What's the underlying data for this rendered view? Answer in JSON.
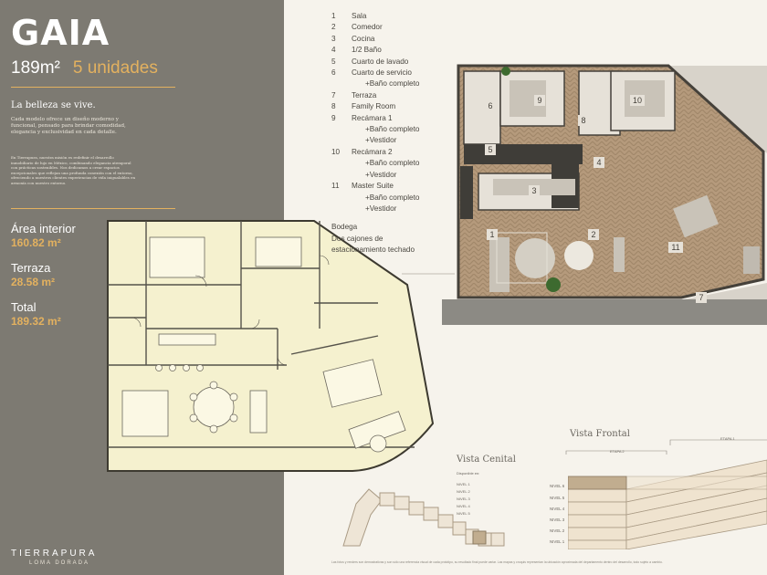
{
  "header": {
    "model_name": "GAIA",
    "size": "189m²",
    "units": "5 unidades"
  },
  "intro": {
    "tagline": "La belleza se vive.",
    "paragraph1": "Cada modelo ofrece un diseño moderno y funcional, pensado para brindar comodidad, elegancia y exclusividad en cada detalle.",
    "paragraph2": "En Tierrapura, nuestra misión es redefinir el desarrollo inmobiliario de lujo en México, combinando elegancia atemporal con prácticas sostenibles. Nos dedicamos a crear espacios excepcionales que reflejan una profunda conexión con el entorno, ofreciendo a nuestros clientes experiencias de vida inigualables en armonía con nuestro entorno."
  },
  "areas": [
    {
      "label": "Área interior",
      "value": "160.82 m²"
    },
    {
      "label": "Terraza",
      "value": "28.58 m²"
    },
    {
      "label": "Total",
      "value": "189.32 m²"
    }
  ],
  "brand": {
    "name": "TIERRAPURA",
    "location": "LOMA DORADA"
  },
  "room_legend": [
    {
      "num": "1",
      "name": "Sala",
      "extras": []
    },
    {
      "num": "2",
      "name": "Comedor",
      "extras": []
    },
    {
      "num": "3",
      "name": "Cocina",
      "extras": []
    },
    {
      "num": "4",
      "name": "1/2 Baño",
      "extras": []
    },
    {
      "num": "5",
      "name": "Cuarto de lavado",
      "extras": []
    },
    {
      "num": "6",
      "name": "Cuarto de servicio",
      "extras": [
        "+Baño completo"
      ]
    },
    {
      "num": "7",
      "name": "Terraza",
      "extras": []
    },
    {
      "num": "8",
      "name": "Family Room",
      "extras": []
    },
    {
      "num": "9",
      "name": "Recámara 1",
      "extras": [
        "+Baño completo",
        "+Vestidor"
      ]
    },
    {
      "num": "10",
      "name": "Recámara 2",
      "extras": [
        "+Baño completo",
        "+Vestidor"
      ]
    },
    {
      "num": "11",
      "name": "Master Suite",
      "extras": [
        "+Baño completo",
        "+Vestidor"
      ]
    }
  ],
  "extras": [
    "Bodega",
    "Dos cajones de",
    "estacionamiento techado"
  ],
  "plan_numbers": [
    "1",
    "2",
    "3",
    "4",
    "5",
    "6",
    "7",
    "8",
    "9",
    "10",
    "11"
  ],
  "vista_cenital": {
    "title": "Vista Cenital",
    "subtitle": "Disponible en:",
    "levels": [
      "NIVEL 1",
      "NIVEL 2",
      "NIVEL 3",
      "NIVEL 4",
      "NIVEL 5"
    ]
  },
  "vista_frontal": {
    "title": "Vista Frontal",
    "etapa1": "ETAPA 1",
    "etapa2": "ETAPA 2",
    "levels": [
      "NIVEL 6",
      "NIVEL 5",
      "NIVEL 4",
      "NIVEL 3",
      "NIVEL 2",
      "NIVEL 1"
    ]
  },
  "footnote": "Las fotos y renders son demostrativas y son sólo una referencia visual de cada prototipo, su resultado final puede variar. Las mapas y croquis representan la ubicación aproximada del departamento dentro del desarrollo, todo sujeto a cambio.",
  "colors": {
    "panel": "#7d7a72",
    "accent": "#e3b15f",
    "background": "#f6f3ec",
    "plan_fill": "#f5f1cf"
  }
}
